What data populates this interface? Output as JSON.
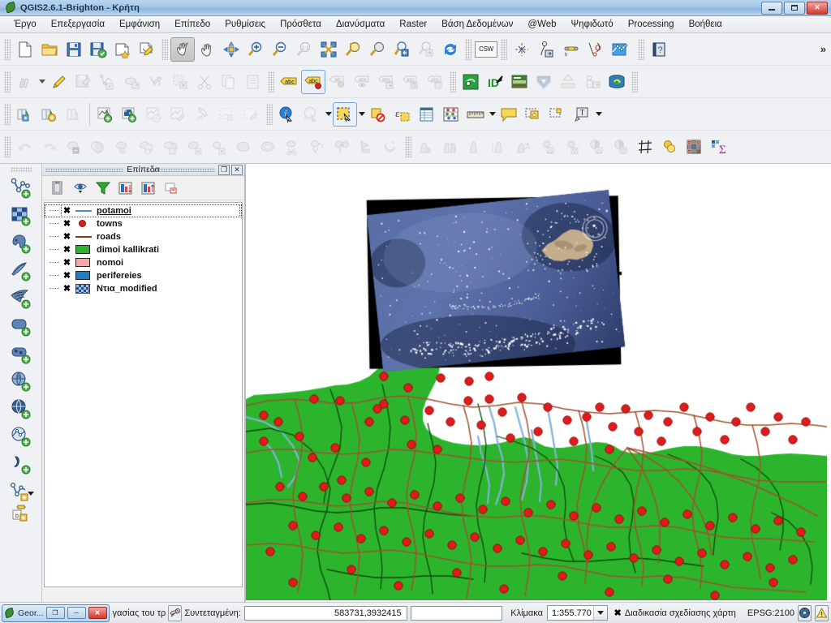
{
  "window": {
    "title": "QGIS2.6.1-Brighton - Κρήτη",
    "app_icon": "qgis-leaf-icon",
    "minimize_label": "",
    "maximize_label": "",
    "close_label": "✕"
  },
  "menubar": {
    "items": [
      {
        "label": "Έργο",
        "name": "menu-project"
      },
      {
        "label": "Επεξεργασία",
        "name": "menu-edit"
      },
      {
        "label": "Εμφάνιση",
        "name": "menu-view"
      },
      {
        "label": "Επίπεδο",
        "name": "menu-layer"
      },
      {
        "label": "Ρυθμίσεις",
        "name": "menu-settings"
      },
      {
        "label": "Πρόσθετα",
        "name": "menu-plugins"
      },
      {
        "label": "Διανύσματα",
        "name": "menu-vector"
      },
      {
        "label": "Raster",
        "name": "menu-raster"
      },
      {
        "label": "Βάση Δεδομένων",
        "name": "menu-database"
      },
      {
        "label": "@Web",
        "name": "menu-web"
      },
      {
        "label": "Ψηφιδωτό",
        "name": "menu-mosaic"
      },
      {
        "label": "Processing",
        "name": "menu-processing"
      },
      {
        "label": "Βοήθεια",
        "name": "menu-help"
      }
    ]
  },
  "toolbars": {
    "overflow_label": "»",
    "csw_label": "CSW",
    "row1": [
      "new-project-icon",
      "open-project-icon",
      "save-project-icon",
      "save-project-as-icon",
      "new-print-composer-icon",
      "composer-manager-icon",
      "pan-map-icon",
      "pan-to-selection-icon",
      "zoom-in-icon",
      "zoom-out-icon",
      "zoom-native-icon",
      "zoom-full-icon",
      "zoom-to-selection-icon",
      "zoom-to-layer-icon",
      "zoom-last-icon",
      "zoom-next-icon",
      "refresh-icon",
      "csw-search-icon",
      "vertex-tool-icon",
      "offset-curve-icon",
      "node-tool-icon",
      "reshape-features-icon",
      "delaunay-icon",
      "help-icon"
    ],
    "row2": [
      "current-edits-icon",
      "toggle-editing-icon",
      "save-layer-edits-icon",
      "add-feature-icon",
      "move-feature-icon",
      "node-edit-icon",
      "delete-selected-icon",
      "cut-features-icon",
      "copy-features-icon",
      "paste-features-icon",
      "label-icon",
      "label-pin-icon",
      "label-hide-icon",
      "label-show-icon",
      "label-move-icon",
      "label-rotate-icon",
      "label-change-icon",
      "plugin-green-icon",
      "id-arrow-icon",
      "raster-image-icon",
      "shield-down-icon",
      "shield-up-icon",
      "elephant-export-icon",
      "db-manager-icon"
    ],
    "row3": [
      "open-attribute-table-import-icon",
      "open-attribute-table-settings-icon",
      "open-table-icon",
      "new-map-add-icon",
      "new-raster-add-icon",
      "map-star-icon",
      "map-edit-icon",
      "pin-icon",
      "print-dotted-icon",
      "print-dotted-edit-icon",
      "identify-features-icon",
      "map-tips-icon",
      "select-features-icon",
      "deselect-features-icon",
      "select-by-expression-icon",
      "open-attribute-table2-icon",
      "statistics-icon",
      "measure-line-icon",
      "text-annotation-icon",
      "html-annotation-icon",
      "svg-annotation-icon",
      "form-annotation-icon"
    ],
    "row4": [
      "undo-icon",
      "redo-icon",
      "clip-icon",
      "intersect-icon",
      "union-icon",
      "symmetrical-difference-icon",
      "dissolve-icon",
      "difference-icon",
      "erase-icon",
      "convex-hull-icon",
      "buffer-icon",
      "simplify-icon",
      "multipart-to-single-icon",
      "singlepart-to-multi-icon",
      "polygon-centroid-icon",
      "rotate-icon",
      "histogram-icon",
      "histogram-2-icon",
      "histogram-3-icon",
      "histogram-4-icon",
      "raster-merge-icon",
      "contrast-up-icon",
      "contrast-down-icon",
      "brightness-up-icon",
      "brightness-down-icon",
      "grid-icon",
      "merge-icon",
      "raster-calculator-icon",
      "sigma-statistics-icon"
    ]
  },
  "vertical_toolbar": {
    "items": [
      "add-vector-layer-icon",
      "add-raster-layer-icon",
      "add-postgis-layer-icon",
      "add-spatialite-layer-icon",
      "add-mssql-layer-icon",
      "add-oracle-layer-icon",
      "add-db2-layer-icon",
      "add-wms-layer-icon",
      "add-wcs-layer-icon",
      "add-wfs-layer-icon",
      "add-delimited-text-layer-icon",
      "new-vector-layer-icon",
      "new-memory-layer-icon"
    ]
  },
  "layers_panel": {
    "title": "Επίπεδα",
    "float_button": "❐",
    "close_button": "✕",
    "toolbar_icons": [
      "layer-styling-icon",
      "filter-legend-icon",
      "filter-legend-expression-icon",
      "expand-all-icon",
      "collapse-all-icon",
      "remove-layer-icon"
    ],
    "layers": [
      {
        "name": "potamoi",
        "symbol": "line-blue",
        "checked": true,
        "selected": true
      },
      {
        "name": "towns",
        "symbol": "point-red",
        "checked": true,
        "selected": false
      },
      {
        "name": "roads",
        "symbol": "line-brown",
        "checked": true,
        "selected": false
      },
      {
        "name": "dimoi kallikrati",
        "symbol": "fill-green",
        "checked": true,
        "selected": false
      },
      {
        "name": "nomoi",
        "symbol": "fill-pink",
        "checked": true,
        "selected": false
      },
      {
        "name": "perifereies",
        "symbol": "fill-blue",
        "checked": true,
        "selected": false
      },
      {
        "name": "Ντια_modified",
        "symbol": "raster",
        "checked": true,
        "selected": false
      }
    ],
    "checkbox_glyph": "✖"
  },
  "map": {
    "layer_colors": {
      "land_green": "#2cb52c",
      "roads_brown": "#a0522d",
      "rivers_blue": "#7fb3d5",
      "town_red": "#e01b1b",
      "boundary_dark": "#0c4a0c",
      "raster_black": "#000000",
      "sea_blue": "#5a6fa8",
      "island_tan": "#c4ad8c"
    }
  },
  "statusbar": {
    "taskbar_button_label": "Geor...",
    "taskbar_restore": "❐",
    "taskbar_minimize": "─",
    "taskbar_close": "✕",
    "truncated_text": "γασίας του τρ",
    "messages_icon": "messages-icon",
    "coordinate_label": "Συντεταγμένη:",
    "coordinate_value": "583731,3932415",
    "scale_label": "Κλίμακα",
    "scale_value": "1:355.770",
    "render_checkbox": "✖",
    "render_label": "Διαδικασία σχεδίασης χάρτη",
    "crs_label": "EPSG:2100",
    "crs_icon": "crs-globe-icon",
    "warning_icon": "warning-icon"
  }
}
